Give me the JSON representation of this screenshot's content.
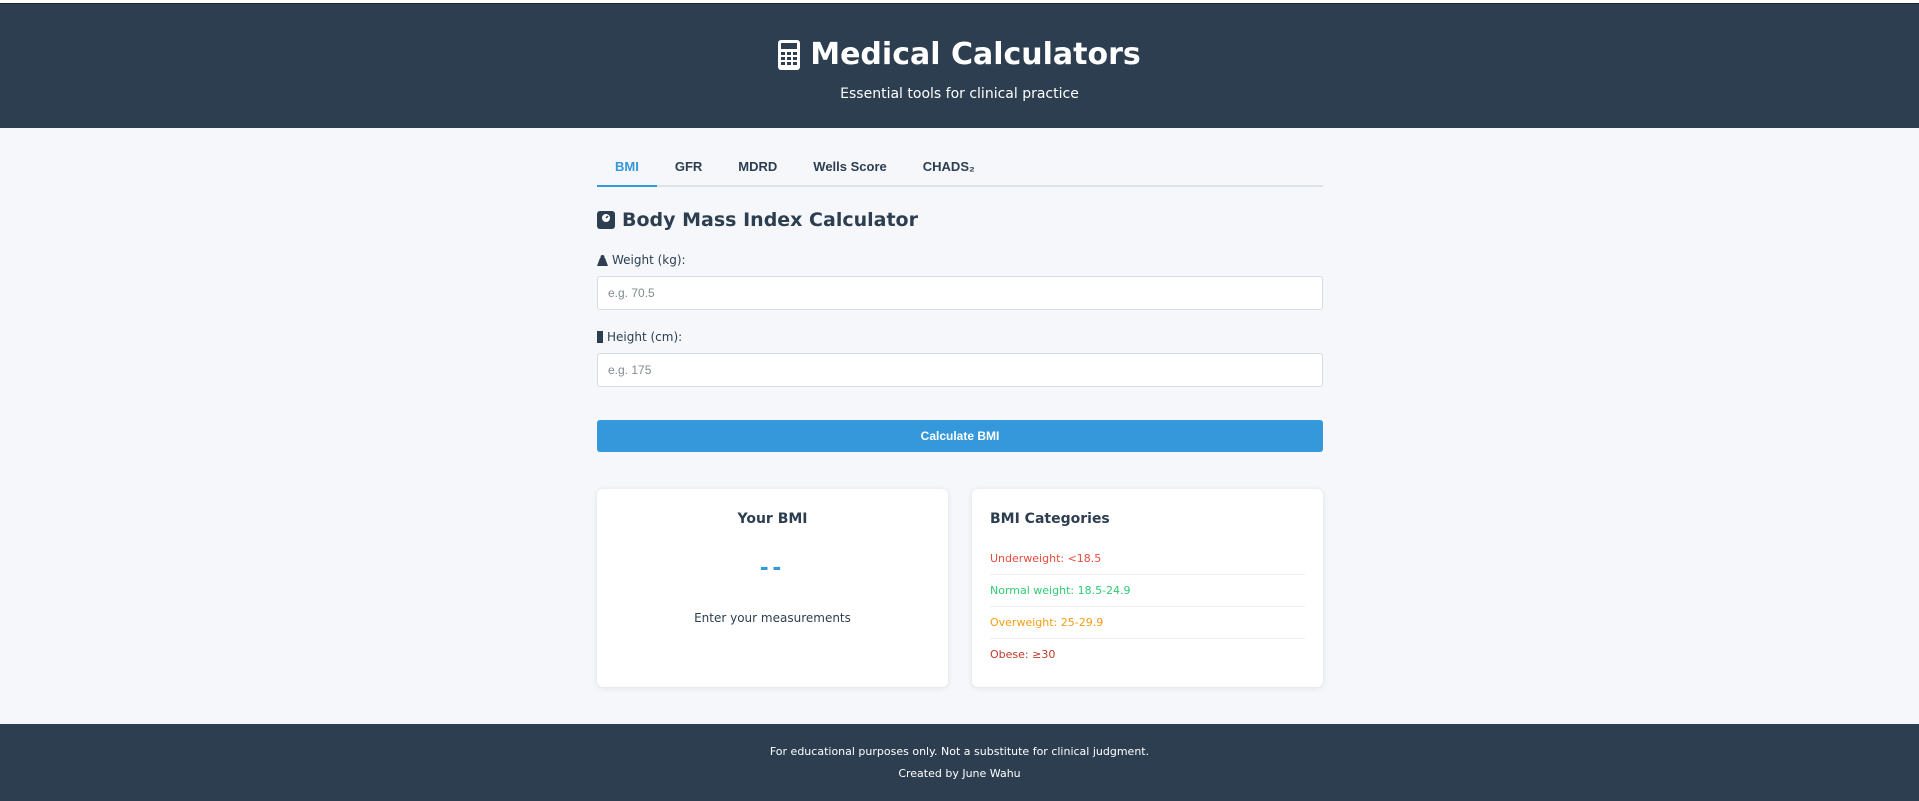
{
  "header": {
    "title": "Medical Calculators",
    "subtitle": "Essential tools for clinical practice",
    "icon": "calculator-icon"
  },
  "tabs": [
    {
      "label": "BMI",
      "active": true
    },
    {
      "label": "GFR",
      "active": false
    },
    {
      "label": "MDRD",
      "active": false
    },
    {
      "label": "Wells Score",
      "active": false
    },
    {
      "label": "CHADS₂",
      "active": false
    }
  ],
  "calculator": {
    "title": "Body Mass Index Calculator",
    "title_icon": "weight-scale-icon",
    "weight": {
      "label": "Weight (kg):",
      "icon": "weight-icon",
      "placeholder": "e.g. 70.5",
      "value": ""
    },
    "height": {
      "label": "Height (cm):",
      "icon": "ruler-icon",
      "placeholder": "e.g. 175",
      "value": ""
    },
    "button_label": "Calculate BMI"
  },
  "result": {
    "title": "Your BMI",
    "value": "--",
    "message": "Enter your measurements"
  },
  "categories": {
    "title": "BMI Categories",
    "items": [
      {
        "label": "Underweight: <18.5",
        "color": "#e74c3c"
      },
      {
        "label": "Normal weight: 18.5-24.9",
        "color": "#2ecc71"
      },
      {
        "label": "Overweight: 25-29.9",
        "color": "#f39c12"
      },
      {
        "label": "Obese: ≥30",
        "color": "#c0392b"
      }
    ]
  },
  "footer": {
    "disclaimer": "For educational purposes only. Not a substitute for clinical judgment.",
    "credit": "Created by June Wahu"
  },
  "colors": {
    "header_bg": "#2c3e50",
    "accent": "#3498db",
    "page_bg": "#f5f7fa"
  }
}
